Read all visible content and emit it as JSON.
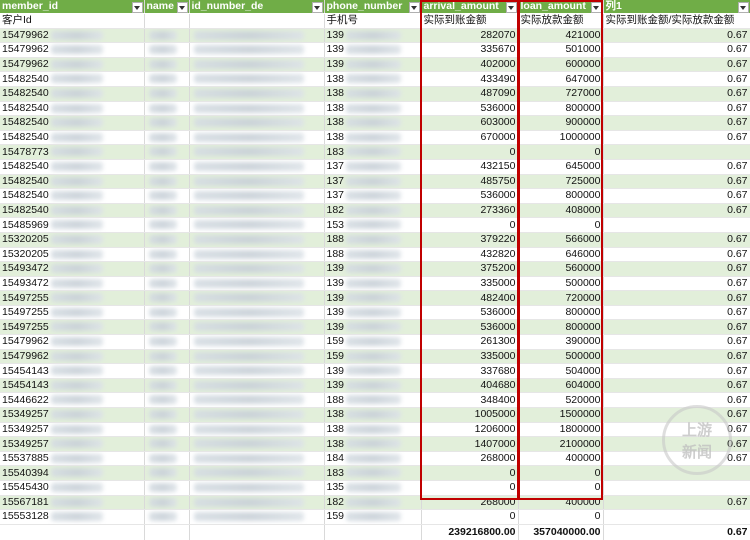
{
  "headers": [
    "member_id",
    "name",
    "id_number_de",
    "",
    "phone_number",
    "arrival_amount",
    "loan_amount",
    "列1"
  ],
  "subheaders": [
    "客户Id",
    "",
    "",
    "",
    "手机号",
    "实际到账金额",
    "实际放款金额",
    "实际到账金额/实际放款金额"
  ],
  "rows": [
    {
      "member_id": "15479962",
      "phone": "139",
      "arrival": "282070",
      "loan": "421000",
      "ratio": "0.67"
    },
    {
      "member_id": "15479962",
      "phone": "139",
      "arrival": "335670",
      "loan": "501000",
      "ratio": "0.67"
    },
    {
      "member_id": "15479962",
      "phone": "139",
      "arrival": "402000",
      "loan": "600000",
      "ratio": "0.67"
    },
    {
      "member_id": "15482540",
      "phone": "138",
      "arrival": "433490",
      "loan": "647000",
      "ratio": "0.67"
    },
    {
      "member_id": "15482540",
      "phone": "138",
      "arrival": "487090",
      "loan": "727000",
      "ratio": "0.67"
    },
    {
      "member_id": "15482540",
      "phone": "138",
      "arrival": "536000",
      "loan": "800000",
      "ratio": "0.67"
    },
    {
      "member_id": "15482540",
      "phone": "138",
      "arrival": "603000",
      "loan": "900000",
      "ratio": "0.67"
    },
    {
      "member_id": "15482540",
      "phone": "138",
      "arrival": "670000",
      "loan": "1000000",
      "ratio": "0.67"
    },
    {
      "member_id": "15478773",
      "phone": "183",
      "arrival": "0",
      "loan": "0",
      "ratio": ""
    },
    {
      "member_id": "15482540",
      "phone": "137",
      "arrival": "432150",
      "loan": "645000",
      "ratio": "0.67"
    },
    {
      "member_id": "15482540",
      "phone": "137",
      "arrival": "485750",
      "loan": "725000",
      "ratio": "0.67"
    },
    {
      "member_id": "15482540",
      "phone": "137",
      "arrival": "536000",
      "loan": "800000",
      "ratio": "0.67"
    },
    {
      "member_id": "15482540",
      "phone": "182",
      "arrival": "273360",
      "loan": "408000",
      "ratio": "0.67"
    },
    {
      "member_id": "15485969",
      "phone": "153",
      "arrival": "0",
      "loan": "0",
      "ratio": ""
    },
    {
      "member_id": "15320205",
      "phone": "188",
      "arrival": "379220",
      "loan": "566000",
      "ratio": "0.67"
    },
    {
      "member_id": "15320205",
      "phone": "188",
      "arrival": "432820",
      "loan": "646000",
      "ratio": "0.67"
    },
    {
      "member_id": "15493472",
      "phone": "139",
      "arrival": "375200",
      "loan": "560000",
      "ratio": "0.67"
    },
    {
      "member_id": "15493472",
      "phone": "139",
      "arrival": "335000",
      "loan": "500000",
      "ratio": "0.67"
    },
    {
      "member_id": "15497255",
      "phone": "139",
      "arrival": "482400",
      "loan": "720000",
      "ratio": "0.67"
    },
    {
      "member_id": "15497255",
      "phone": "139",
      "arrival": "536000",
      "loan": "800000",
      "ratio": "0.67"
    },
    {
      "member_id": "15497255",
      "phone": "139",
      "arrival": "536000",
      "loan": "800000",
      "ratio": "0.67"
    },
    {
      "member_id": "15479962",
      "phone": "159",
      "arrival": "261300",
      "loan": "390000",
      "ratio": "0.67"
    },
    {
      "member_id": "15479962",
      "phone": "159",
      "arrival": "335000",
      "loan": "500000",
      "ratio": "0.67"
    },
    {
      "member_id": "15454143",
      "phone": "139",
      "arrival": "337680",
      "loan": "504000",
      "ratio": "0.67"
    },
    {
      "member_id": "15454143",
      "phone": "139",
      "arrival": "404680",
      "loan": "604000",
      "ratio": "0.67"
    },
    {
      "member_id": "15446622",
      "phone": "188",
      "arrival": "348400",
      "loan": "520000",
      "ratio": "0.67"
    },
    {
      "member_id": "15349257",
      "phone": "138",
      "arrival": "1005000",
      "loan": "1500000",
      "ratio": "0.67"
    },
    {
      "member_id": "15349257",
      "phone": "138",
      "arrival": "1206000",
      "loan": "1800000",
      "ratio": "0.67"
    },
    {
      "member_id": "15349257",
      "phone": "138",
      "arrival": "1407000",
      "loan": "2100000",
      "ratio": "0.67"
    },
    {
      "member_id": "15537885",
      "phone": "184",
      "arrival": "268000",
      "loan": "400000",
      "ratio": "0.67"
    },
    {
      "member_id": "15540394",
      "phone": "183",
      "arrival": "0",
      "loan": "0",
      "ratio": ""
    },
    {
      "member_id": "15545430",
      "phone": "135",
      "arrival": "0",
      "loan": "0",
      "ratio": ""
    },
    {
      "member_id": "15567181",
      "phone": "182",
      "arrival": "268000",
      "loan": "400000",
      "ratio": "0.67"
    },
    {
      "member_id": "15553128",
      "phone": "159",
      "arrival": "0",
      "loan": "0",
      "ratio": ""
    }
  ],
  "totals": {
    "arrival": "239216800.00",
    "loan": "357040000.00",
    "ratio": "0.67"
  },
  "watermark": {
    "line1": "上游",
    "line2": "新闻"
  },
  "colors": {
    "header": "#70ad47",
    "band": "#e2efda",
    "highlight": "#c00000"
  }
}
